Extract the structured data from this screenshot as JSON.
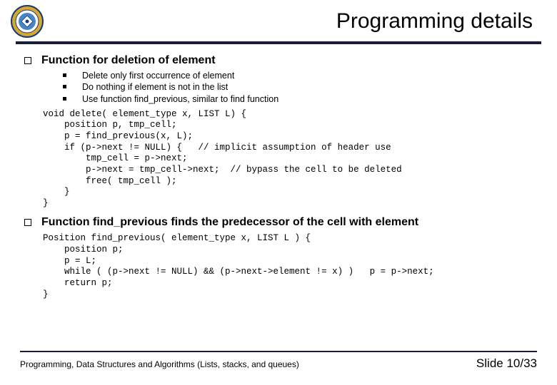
{
  "title": "Programming details",
  "sections": [
    {
      "heading": "Function for deletion of element",
      "bullets": [
        "Delete only first  occurrence of element",
        "Do nothing if element is not in the list",
        "Use function find_previous, similar to find function"
      ],
      "code": "void delete( element_type x, LIST L) {\n    position p, tmp_cell;\n    p = find_previous(x, L);\n    if (p->next != NULL) {   // implicit assumption of header use\n        tmp_cell = p->next;\n        p->next = tmp_cell->next;  // bypass the cell to be deleted\n        free( tmp_cell );\n    }\n}"
    },
    {
      "heading": "Function find_previous finds the predecessor of the cell with element",
      "bullets": [],
      "code": "Position find_previous( element_type x, LIST L ) {\n    position p;\n    p = L;\n    while ( (p->next != NULL) && (p->next->element != x) )   p = p->next;\n    return p;\n}"
    }
  ],
  "footer": {
    "left": "Programming, Data Structures and Algorithms  (Lists, stacks, and queues)",
    "right": "Slide 10/33"
  }
}
